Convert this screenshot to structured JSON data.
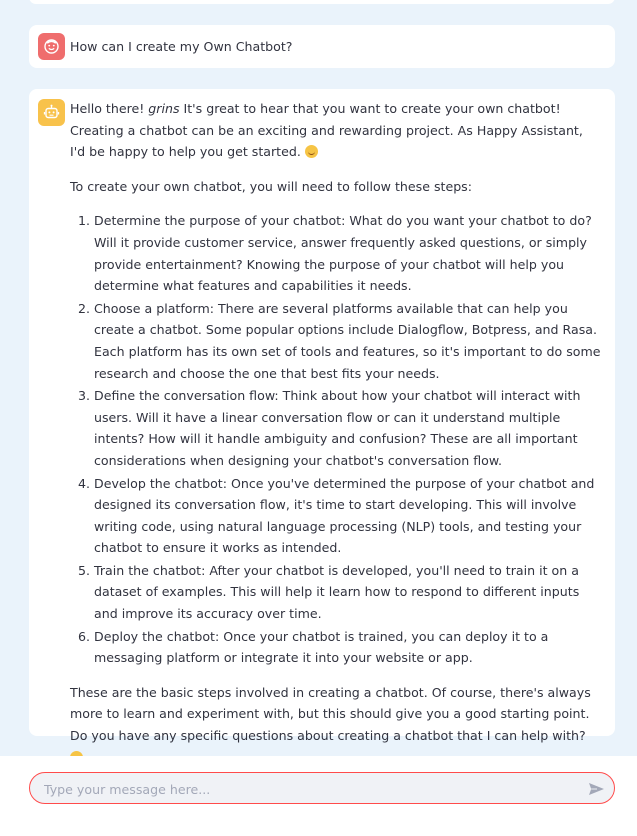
{
  "colors": {
    "background": "#eaf3fb",
    "bubble": "#ffffff",
    "user_avatar": "#ef6d6d",
    "bot_avatar": "#f8c24b",
    "input_border": "#ff4b4b"
  },
  "user_message": {
    "avatar_icon": "user-face-icon",
    "text": "How can I create my Own Chatbot?"
  },
  "bot_message": {
    "avatar_icon": "robot-icon",
    "intro_greeting": "Hello there! ",
    "intro_emphasis": "grins",
    "intro_rest": " It's great to hear that you want to create your own chatbot! Creating a chatbot can be an exciting and rewarding project. As Happy Assistant, I'd be happy to help you get started. ",
    "steps_intro": "To create your own chatbot, you will need to follow these steps:",
    "steps": [
      "Determine the purpose of your chatbot: What do you want your chatbot to do? Will it provide customer service, answer frequently asked questions, or simply provide entertainment? Knowing the purpose of your chatbot will help you determine what features and capabilities it needs.",
      "Choose a platform: There are several platforms available that can help you create a chatbot. Some popular options include Dialogflow, Botpress, and Rasa. Each platform has its own set of tools and features, so it's important to do some research and choose the one that best fits your needs.",
      "Define the conversation flow: Think about how your chatbot will interact with users. Will it have a linear conversation flow or can it understand multiple intents? How will it handle ambiguity and confusion? These are all important considerations when designing your chatbot's conversation flow.",
      "Develop the chatbot: Once you've determined the purpose of your chatbot and designed its conversation flow, it's time to start developing. This will involve writing code, using natural language processing (NLP) tools, and testing your chatbot to ensure it works as intended.",
      "Train the chatbot: After your chatbot is developed, you'll need to train it on a dataset of examples. This will help it learn how to respond to different inputs and improve its accuracy over time.",
      "Deploy the chatbot: Once your chatbot is trained, you can deploy it to a messaging platform or integrate it into your website or app."
    ],
    "closing": "These are the basic steps involved in creating a chatbot. Of course, there's always more to learn and experiment with, but this should give you a good starting point. Do you have any specific questions about creating a chatbot that I can help with? "
  },
  "input": {
    "placeholder": "Type your message here...",
    "value": "",
    "send_icon": "send-icon"
  }
}
